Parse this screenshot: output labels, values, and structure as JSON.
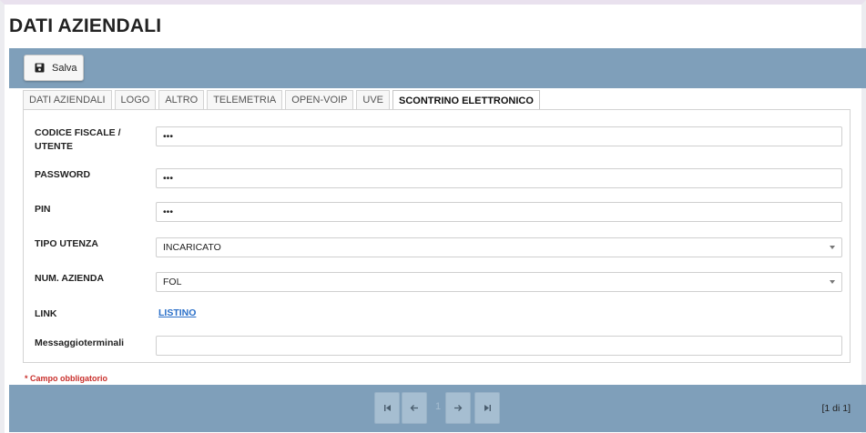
{
  "page": {
    "title": "DATI AZIENDALI"
  },
  "toolbar": {
    "save_label": "Salva"
  },
  "tabs": [
    {
      "label": "DATI AZIENDALI"
    },
    {
      "label": "LOGO"
    },
    {
      "label": "ALTRO"
    },
    {
      "label": "TELEMETRIA"
    },
    {
      "label": "OPEN-VOIP"
    },
    {
      "label": "UVE"
    },
    {
      "label": "SCONTRINO ELETTRONICO",
      "active": true
    }
  ],
  "form": {
    "codice_fiscale": {
      "label_line1": "CODICE FISCALE /",
      "label_line2": "UTENTE",
      "value": "•••"
    },
    "password": {
      "label": "PASSWORD",
      "value": "•••"
    },
    "pin": {
      "label": "PIN",
      "value": "•••"
    },
    "tipo_utenza": {
      "label": "TIPO UTENZA",
      "value": "INCARICATO"
    },
    "num_azienda": {
      "label": "NUM. AZIENDA",
      "value": "FOL"
    },
    "link": {
      "label": "LINK",
      "value": "LISTINO"
    },
    "messaggio": {
      "label": "Messaggioterminali",
      "value": ""
    }
  },
  "required_note": "* Campo obbligatorio",
  "pagination": {
    "current_page": "1",
    "info": "[1 di 1]"
  },
  "colors": {
    "bar": "#7f9fba",
    "link": "#2a6fc8",
    "required": "#c9302c"
  }
}
